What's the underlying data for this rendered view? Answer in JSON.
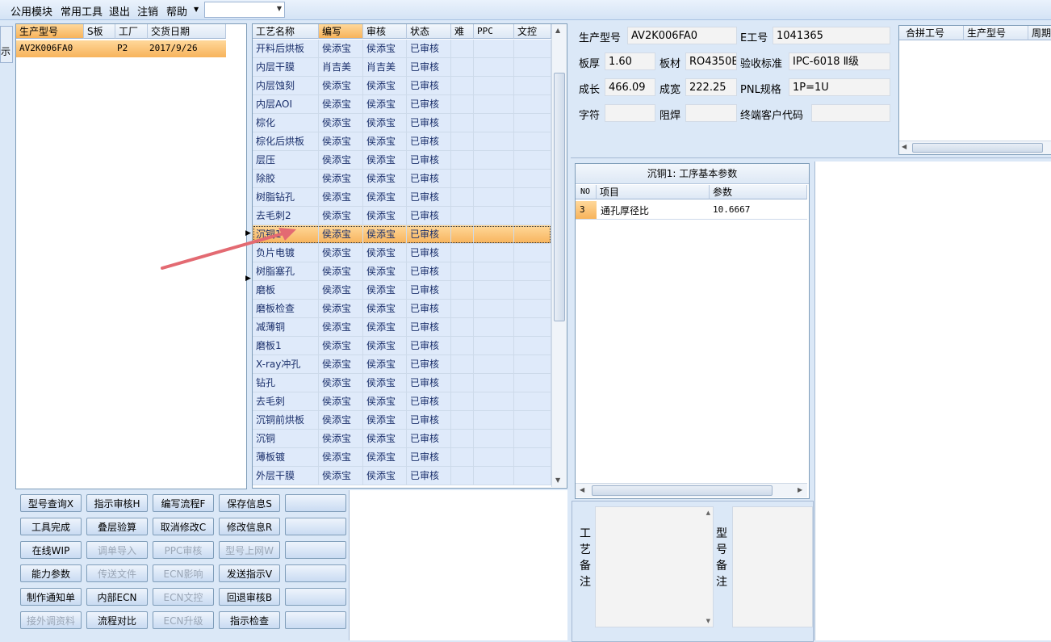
{
  "menu": {
    "items": [
      "公用模块",
      "常用工具",
      "退出",
      "注销",
      "帮助"
    ],
    "combo_value": ""
  },
  "left_edge": {
    "tab_label": "示"
  },
  "model_grid": {
    "headers": [
      "生产型号",
      "S板",
      "工厂",
      "交货日期"
    ],
    "rows": [
      {
        "model": "AV2K006FA0",
        "s_board": "",
        "factory": "P2",
        "delivery": "2017/9/26"
      }
    ]
  },
  "process_grid": {
    "headers": [
      "工艺名称",
      "编写",
      "审核",
      "状态",
      "难",
      "PPC",
      "文控"
    ],
    "rows": [
      {
        "name": "开料后烘板",
        "writer": "侯添宝",
        "reviewer": "侯添宝",
        "status": "已审核"
      },
      {
        "name": "内层干膜",
        "writer": "肖吉美",
        "reviewer": "肖吉美",
        "status": "已审核"
      },
      {
        "name": "内层蚀刻",
        "writer": "侯添宝",
        "reviewer": "侯添宝",
        "status": "已审核"
      },
      {
        "name": "内层AOI",
        "writer": "侯添宝",
        "reviewer": "侯添宝",
        "status": "已审核"
      },
      {
        "name": "棕化",
        "writer": "侯添宝",
        "reviewer": "侯添宝",
        "status": "已审核"
      },
      {
        "name": "棕化后烘板",
        "writer": "侯添宝",
        "reviewer": "侯添宝",
        "status": "已审核"
      },
      {
        "name": "层压",
        "writer": "侯添宝",
        "reviewer": "侯添宝",
        "status": "已审核"
      },
      {
        "name": "除胶",
        "writer": "侯添宝",
        "reviewer": "侯添宝",
        "status": "已审核"
      },
      {
        "name": "树脂钻孔",
        "writer": "侯添宝",
        "reviewer": "侯添宝",
        "status": "已审核"
      },
      {
        "name": "去毛刺2",
        "writer": "侯添宝",
        "reviewer": "侯添宝",
        "status": "已审核"
      },
      {
        "name": "沉铜1",
        "writer": "侯添宝",
        "reviewer": "侯添宝",
        "status": "已审核"
      },
      {
        "name": "负片电镀",
        "writer": "侯添宝",
        "reviewer": "侯添宝",
        "status": "已审核"
      },
      {
        "name": "树脂塞孔",
        "writer": "侯添宝",
        "reviewer": "侯添宝",
        "status": "已审核"
      },
      {
        "name": "磨板",
        "writer": "侯添宝",
        "reviewer": "侯添宝",
        "status": "已审核"
      },
      {
        "name": "磨板检查",
        "writer": "侯添宝",
        "reviewer": "侯添宝",
        "status": "已审核"
      },
      {
        "name": "减薄铜",
        "writer": "侯添宝",
        "reviewer": "侯添宝",
        "status": "已审核"
      },
      {
        "name": "磨板1",
        "writer": "侯添宝",
        "reviewer": "侯添宝",
        "status": "已审核"
      },
      {
        "name": "X-ray冲孔",
        "writer": "侯添宝",
        "reviewer": "侯添宝",
        "status": "已审核"
      },
      {
        "name": "钻孔",
        "writer": "侯添宝",
        "reviewer": "侯添宝",
        "status": "已审核"
      },
      {
        "name": "去毛刺",
        "writer": "侯添宝",
        "reviewer": "侯添宝",
        "status": "已审核"
      },
      {
        "name": "沉铜前烘板",
        "writer": "侯添宝",
        "reviewer": "侯添宝",
        "status": "已审核"
      },
      {
        "name": "沉铜",
        "writer": "侯添宝",
        "reviewer": "侯添宝",
        "status": "已审核"
      },
      {
        "name": "薄板镀",
        "writer": "侯添宝",
        "reviewer": "侯添宝",
        "status": "已审核"
      },
      {
        "name": "外层干膜",
        "writer": "侯添宝",
        "reviewer": "侯添宝",
        "status": "已审核"
      }
    ]
  },
  "buttons": [
    [
      "型号查询X",
      "指示审核H",
      "编写流程F",
      "保存信息S",
      ""
    ],
    [
      "工具完成",
      "叠层验算",
      "取消修改C",
      "修改信息R",
      ""
    ],
    [
      "在线WIP",
      "调单导入",
      "PPC审核",
      "型号上网W",
      ""
    ],
    [
      "能力参数",
      "传送文件",
      "ECN影响",
      "发送指示V",
      ""
    ],
    [
      "制作通知单",
      "内部ECN",
      "ECN文控",
      "回退审核B",
      ""
    ],
    [
      "接外调资料",
      "流程对比",
      "ECN升级",
      "指示检查",
      ""
    ]
  ],
  "info": {
    "model_label": "生产型号",
    "model_value": "AV2K006FA0",
    "eno_label": "E工号",
    "eno_value": "1041365",
    "thickness_label": "板厚",
    "thickness_value": "1.60",
    "material_label": "板材",
    "material_value": "RO4350B",
    "standard_label": "验收标准",
    "standard_value": "IPC-6018 Ⅱ级",
    "length_label": "成长",
    "length_value": "466.09",
    "width_label": "成宽",
    "width_value": "222.25",
    "pnl_label": "PNL规格",
    "pnl_value": "1P=1U",
    "char_label": "字符",
    "char_value": "",
    "mask_label": "阻焊",
    "mask_value": "",
    "customer_label": "终端客户代码",
    "customer_value": ""
  },
  "merge_grid": {
    "headers": [
      "合拼工号",
      "生产型号",
      "周期"
    ]
  },
  "params": {
    "title": "沉铜1: 工序基本参数",
    "headers": [
      "NO",
      "项目",
      "参数"
    ],
    "rows": [
      {
        "no": "3",
        "item": "通孔厚径比",
        "value": "10.6667"
      }
    ]
  },
  "notes": {
    "process_label": "工艺备注",
    "model_label": "型号备注"
  }
}
